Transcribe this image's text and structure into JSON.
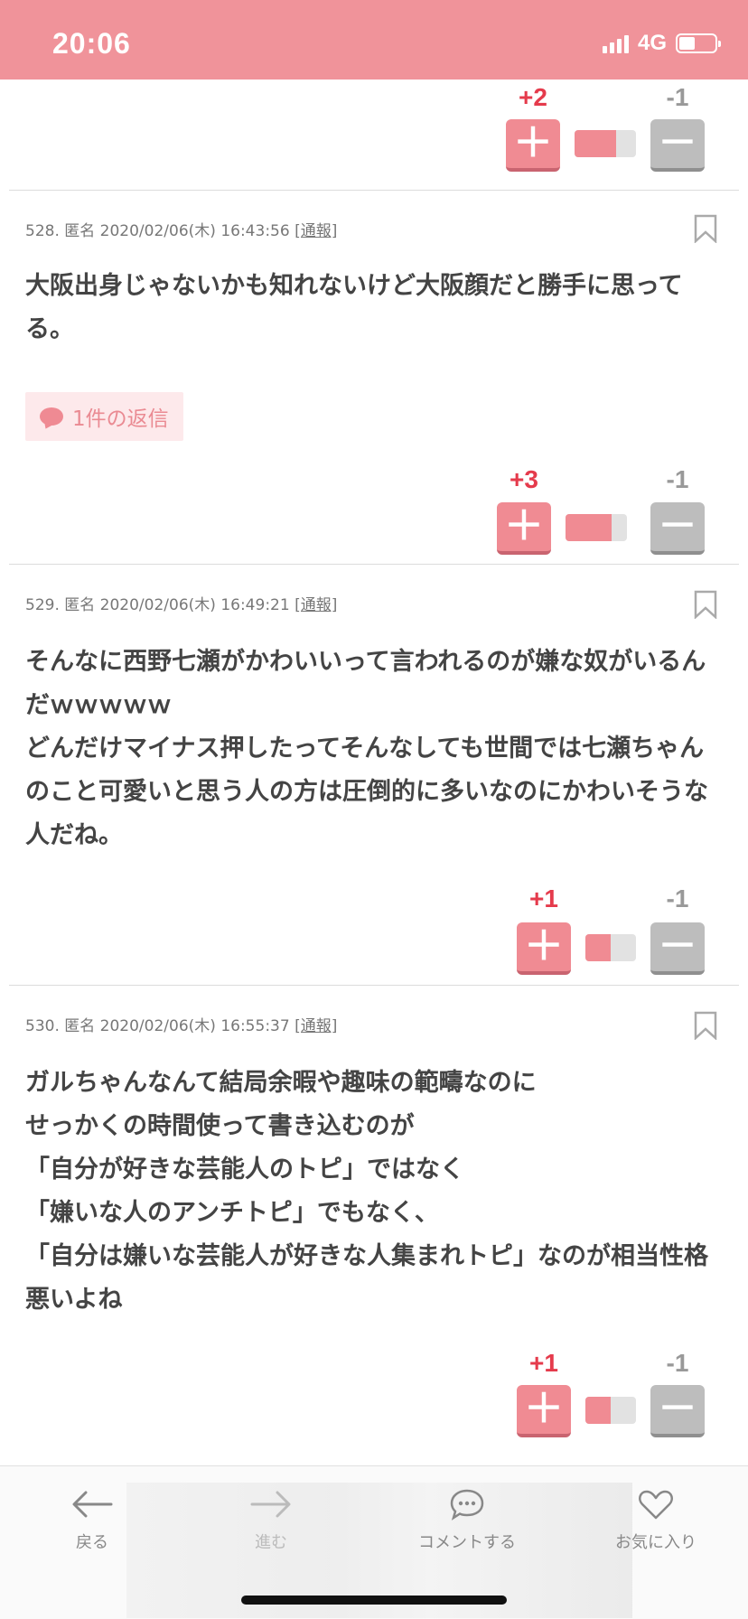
{
  "status_bar": {
    "time": "20:06",
    "network": "4G",
    "battery_level": 0.45
  },
  "posts": [
    {
      "number": "528.",
      "author": "匿名",
      "timestamp": "2020/02/06(木) 16:43:56",
      "report_label": "[通報]",
      "body": "大阪出身じゃないかも知れないけど大阪顔だと勝手に思ってる。",
      "reply_badge": "1件の返信",
      "plus_count": "+3",
      "minus_count": "-1",
      "plus_ratio": 0.75
    },
    {
      "number": "529.",
      "author": "匿名",
      "timestamp": "2020/02/06(木) 16:49:21",
      "report_label": "[通報]",
      "body": "そんなに西野七瀬がかわいいって言われるのが嫌な奴がいるんだｗｗｗｗｗ\nどんだけマイナス押したってそんなしても世間では七瀬ちゃんのこと可愛いと思う人の方は圧倒的に多いなのにかわいそうな人だね。",
      "plus_count": "+1",
      "minus_count": "-1",
      "plus_ratio": 0.5
    },
    {
      "number": "530.",
      "author": "匿名",
      "timestamp": "2020/02/06(木) 16:55:37",
      "report_label": "[通報]",
      "body": "ガルちゃんなんて結局余暇や趣味の範疇なのに\nせっかくの時間使って書き込むのが\n「自分が好きな芸能人のトピ」ではなく\n「嫌いな人のアンチトピ」でもなく、\n「自分は嫌いな芸能人が好きな人集まれトピ」なのが相当性格悪いよね",
      "plus_count": "+1",
      "minus_count": "-1",
      "plus_ratio": 0.5
    }
  ],
  "prev_post_votes": {
    "plus_count": "+2",
    "minus_count": "-1",
    "plus_ratio": 0.67
  },
  "bottom_nav": {
    "back_label": "戻る",
    "forward_label": "進む",
    "comment_label": "コメントする",
    "favorite_label": "お気に入り"
  },
  "colors": {
    "accent": "#f0939a",
    "plus": "#e53b4c",
    "vote_plus_bg": "#f08b93",
    "vote_minus_bg": "#bdbdbd"
  }
}
